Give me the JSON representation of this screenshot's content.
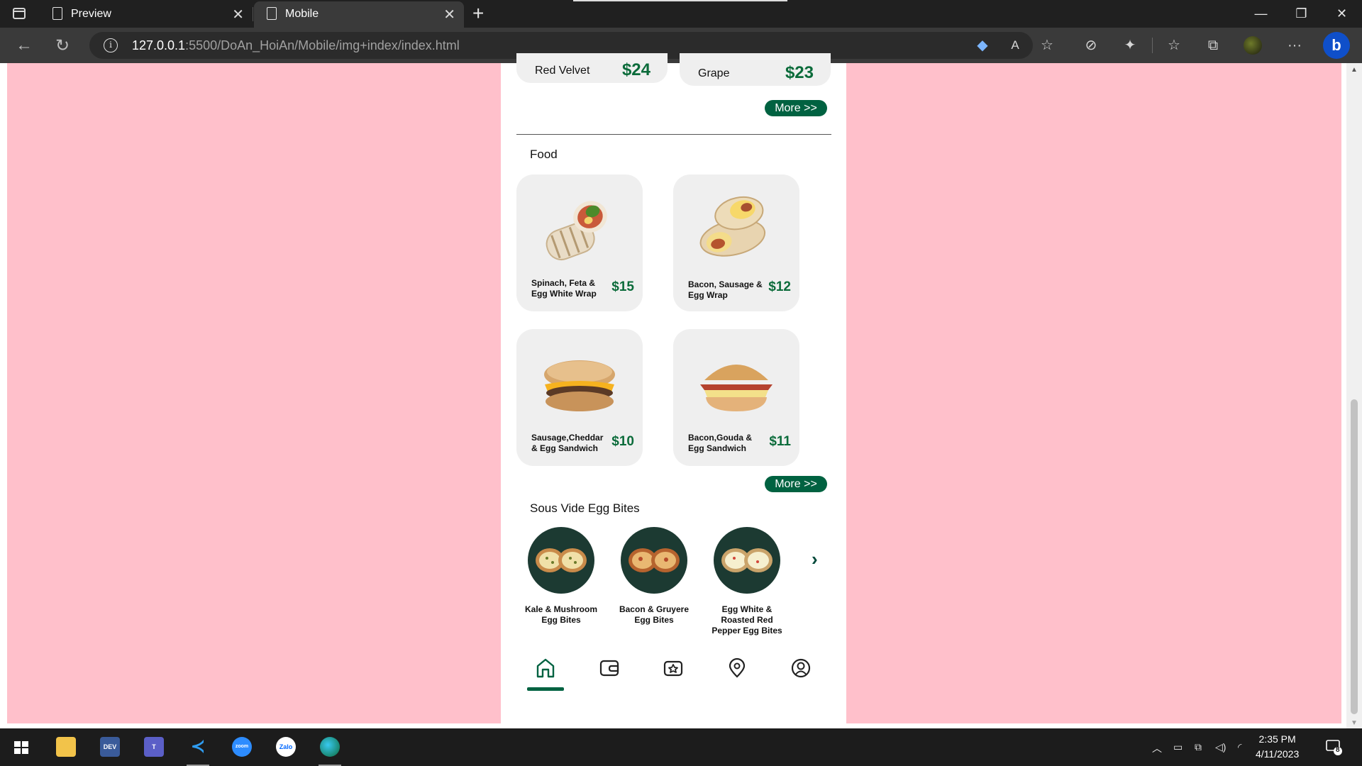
{
  "browser": {
    "tabs": [
      {
        "title": "Preview"
      },
      {
        "title": "Mobile"
      }
    ],
    "url_host": "127.0.0.1",
    "url_rest": ":5500/DoAn_HoiAn/Mobile/img+index/index.html"
  },
  "drinks": [
    {
      "name": "Red Velvet",
      "price": "$24"
    },
    {
      "name": "Grape",
      "price": "$23"
    }
  ],
  "more_label": "More >>",
  "food": {
    "title": "Food",
    "items": [
      {
        "name": "Spinach, Feta & Egg White Wrap",
        "price": "$15"
      },
      {
        "name": "Bacon, Sausage & Egg Wrap",
        "price": "$12"
      },
      {
        "name": "Sausage,Cheddar & Egg Sandwich",
        "price": "$10"
      },
      {
        "name": "Bacon,Gouda & Egg Sandwich",
        "price": "$11"
      }
    ]
  },
  "egg_bites": {
    "title": "Sous Vide Egg Bites",
    "items": [
      {
        "name": "Kale & Mushroom Egg Bites"
      },
      {
        "name": "Bacon & Gruyere Egg Bites"
      },
      {
        "name": "Egg White & Roasted Red Pepper Egg Bites"
      }
    ]
  },
  "bottom_nav": [
    "home-icon",
    "wallet-icon",
    "gift-icon",
    "location-pin-icon",
    "profile-icon"
  ],
  "colors": {
    "accent_green": "#006241",
    "price_green": "#0b6b3a",
    "page_bg_pink": "#ffc0cb"
  },
  "taskbar": {
    "time": "2:35 PM",
    "date": "4/11/2023",
    "notification_count": "8",
    "dev_label": "DEV",
    "zoom_label": "zoom",
    "zalo_label": "Zalo"
  }
}
